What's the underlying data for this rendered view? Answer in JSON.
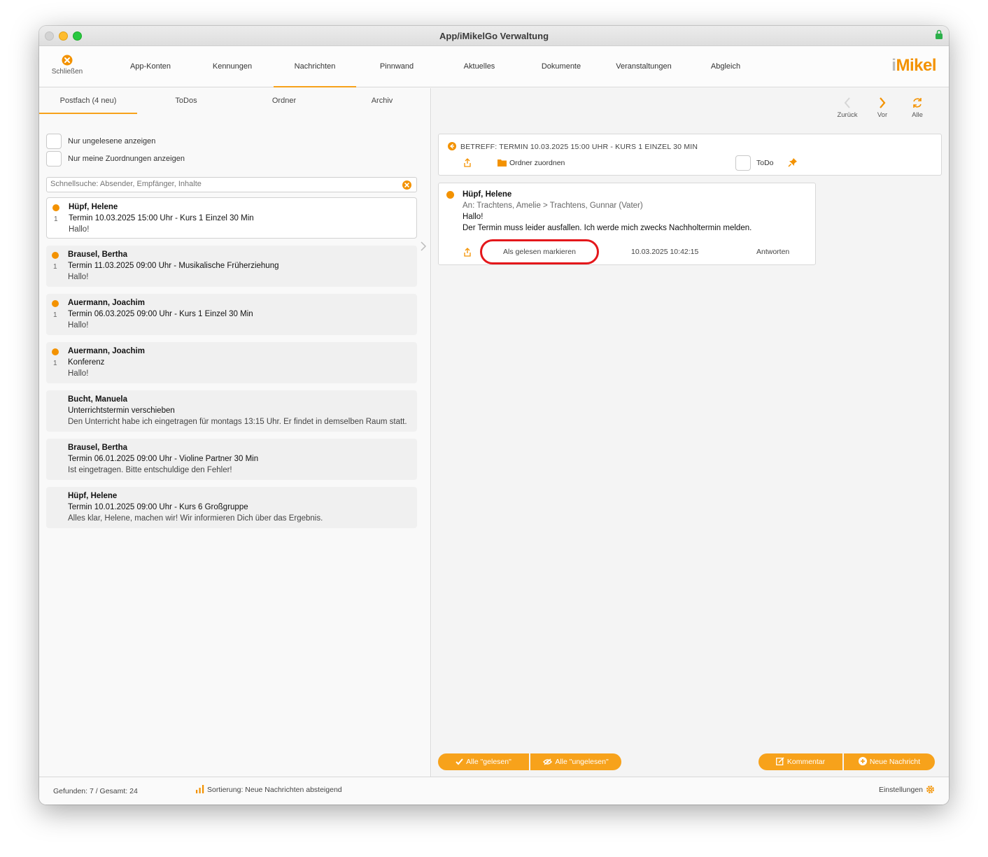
{
  "window": {
    "title": "App/iMikelGo Verwaltung"
  },
  "toolbar": {
    "close_label": "Schließen",
    "nav": [
      "App-Konten",
      "Kennungen",
      "Nachrichten",
      "Pinnwand",
      "Aktuelles",
      "Dokumente",
      "Veranstaltungen",
      "Abgleich"
    ],
    "active_nav": "Nachrichten",
    "logo_i": "i",
    "logo_rest": "Mikel"
  },
  "left": {
    "tabs": [
      "Postfach (4 neu)",
      "ToDos",
      "Ordner",
      "Archiv"
    ],
    "filters": {
      "unread_only": "Nur ungelesene anzeigen",
      "my_assignments": "Nur meine Zuordnungen anzeigen"
    },
    "search": {
      "placeholder": "Schnellsuche: Absender, Empfänger, Inhalte",
      "value": ""
    },
    "messages": [
      {
        "sender": "Hüpf, Helene",
        "subject": "Termin 10.03.2025 15:00 Uhr - Kurs 1 Einzel 30 Min",
        "preview": "Hallo!",
        "count": "1",
        "unread": true
      },
      {
        "sender": "Brausel, Bertha",
        "subject": "Termin 11.03.2025 09:00 Uhr - Musikalische Früherziehung",
        "preview": "Hallo!",
        "count": "1",
        "unread": true
      },
      {
        "sender": "Auermann, Joachim",
        "subject": "Termin 06.03.2025 09:00 Uhr - Kurs 1 Einzel 30 Min",
        "preview": "Hallo!",
        "count": "1",
        "unread": true
      },
      {
        "sender": "Auermann, Joachim",
        "subject": "Konferenz",
        "preview": "Hallo!",
        "count": "1",
        "unread": true
      },
      {
        "sender": "Bucht, Manuela",
        "subject": "Unterrichtstermin verschieben",
        "preview": "Den Unterricht habe ich eingetragen für montags 13:15 Uhr. Er findet in demselben Raum statt.",
        "count": "",
        "unread": false
      },
      {
        "sender": "Brausel, Bertha",
        "subject": "Termin 06.01.2025 09:00 Uhr - Violine Partner 30 Min",
        "preview": "Ist eingetragen. Bitte entschuldige den Fehler!",
        "count": "",
        "unread": false
      },
      {
        "sender": "Hüpf, Helene",
        "subject": "Termin 10.01.2025 09:00 Uhr - Kurs 6 Großgruppe",
        "preview": "Alles klar, Helene, machen wir! Wir informieren Dich über das Ergebnis.",
        "count": "",
        "unread": false
      }
    ]
  },
  "right": {
    "nav": {
      "back": "Zurück",
      "forward": "Vor",
      "all": "Alle"
    },
    "subject": "BETREFF: TERMIN 10.03.2025 15:00 UHR - KURS 1 EINZEL 30 MIN",
    "assign_folder": "Ordner zuordnen",
    "todo_label": "ToDo",
    "detail": {
      "sender": "Hüpf, Helene",
      "to": "An: Trachtens, Amelie > Trachtens, Gunnar (Vater)",
      "body": [
        "Hallo!",
        "Der Termin muss leider ausfallen. Ich werde mich zwecks Nachholtermin melden."
      ],
      "mark_read": "Als gelesen markieren",
      "date": "10.03.2025 10:42:15",
      "reply": "Antworten"
    },
    "buttons": {
      "all_read": "Alle \"gelesen\"",
      "all_unread": "Alle \"ungelesen\"",
      "comment": "Kommentar",
      "new_message": "Neue Nachricht"
    }
  },
  "status": {
    "found": "Gefunden: 7 / Gesamt: 24",
    "sort": "Sortierung: Neue Nachrichten absteigend",
    "settings": "Einstellungen"
  },
  "colors": {
    "accent": "#f7a21b",
    "unread_dot": "#f39200",
    "highlight": "#e4171b"
  }
}
